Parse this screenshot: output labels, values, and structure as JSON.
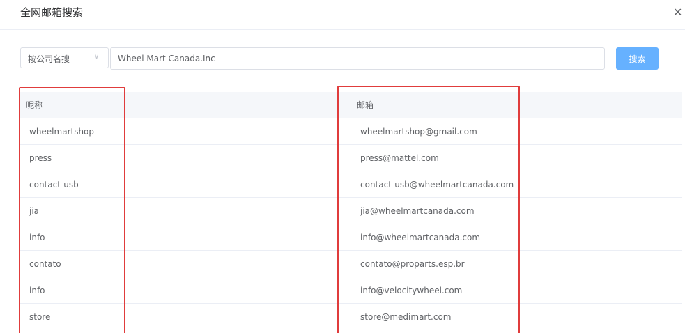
{
  "dialog": {
    "title": "全网邮箱搜索",
    "close_icon": "close-icon"
  },
  "search": {
    "type_label": "按公司名搜",
    "query": "Wheel Mart Canada.Inc",
    "button_label": "搜索",
    "button_color": "#66b1ff"
  },
  "table": {
    "headers": {
      "name": "昵称",
      "email": "邮箱"
    },
    "rows": [
      {
        "name": "wheelmartshop",
        "email": "wheelmartshop@gmail.com"
      },
      {
        "name": "press",
        "email": "press@mattel.com"
      },
      {
        "name": "contact-usb",
        "email": "contact-usb@wheelmartcanada.com"
      },
      {
        "name": "jia",
        "email": "jia@wheelmartcanada.com"
      },
      {
        "name": "info",
        "email": "info@wheelmartcanada.com"
      },
      {
        "name": "contato",
        "email": "contato@proparts.esp.br"
      },
      {
        "name": "info",
        "email": "info@velocitywheel.com"
      },
      {
        "name": "store",
        "email": "store@medimart.com"
      }
    ]
  },
  "highlight_color": "#e03c3c"
}
